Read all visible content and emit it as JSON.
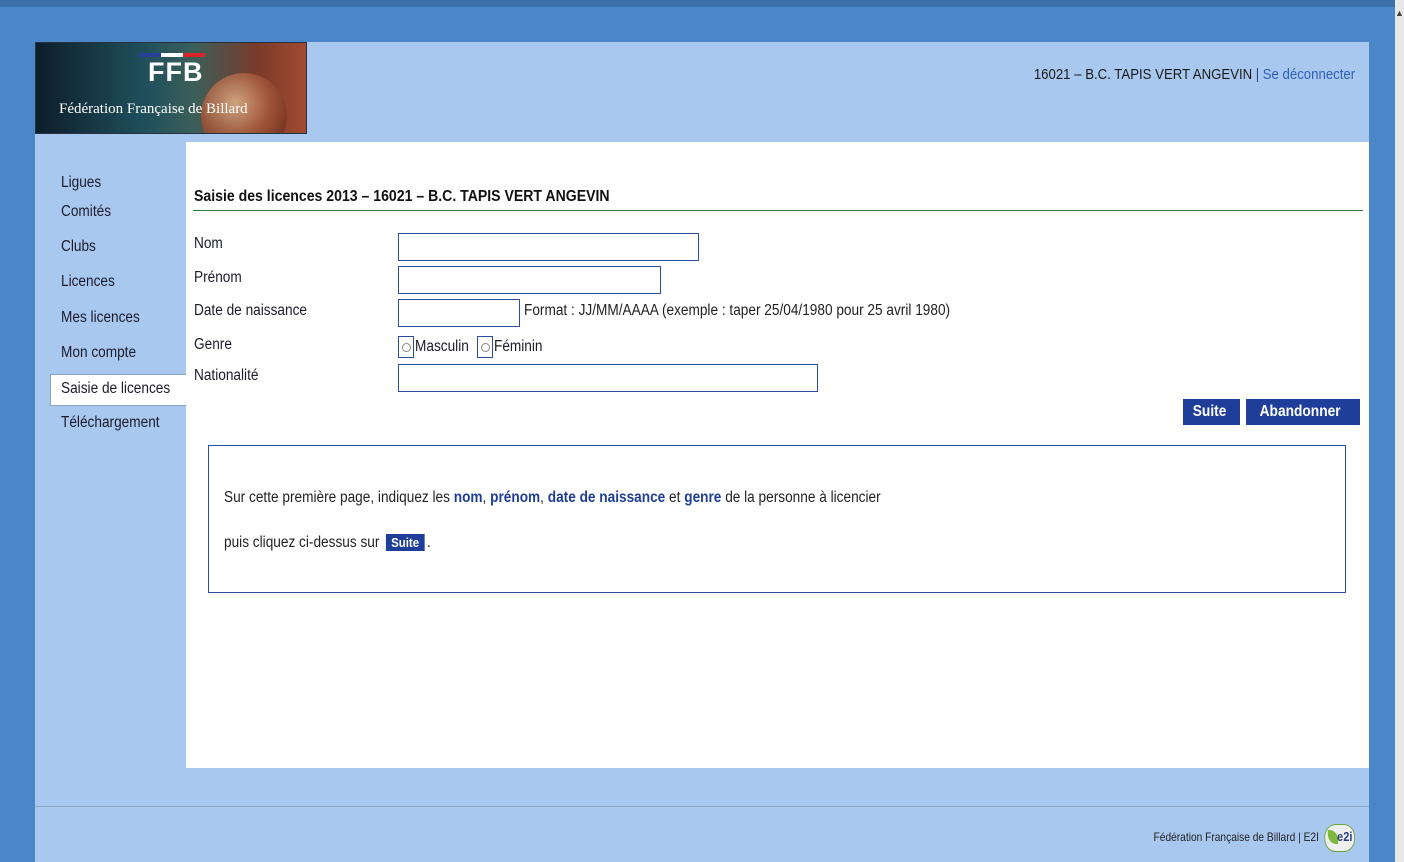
{
  "logo": {
    "brand": "FFB",
    "subtitle": "Fédération Française de Billard",
    "flag_colors": [
      "#2a3f9a",
      "#ffffff",
      "#d8232a"
    ]
  },
  "header": {
    "club": "16021 – B.C. TAPIS VERT ANGEVIN",
    "separator": "|",
    "logout": "Se déconnecter"
  },
  "sidebar": {
    "items": [
      {
        "label": "Ligues"
      },
      {
        "label": "Comités"
      },
      {
        "label": "Clubs"
      },
      {
        "label": "Licences"
      },
      {
        "label": "Mes licences"
      },
      {
        "label": "Mon compte"
      },
      {
        "label": "Saisie de licences",
        "active": true
      },
      {
        "label": "Téléchargement"
      }
    ]
  },
  "form": {
    "title": "Saisie des licences 2013 – 16021 – B.C. TAPIS VERT ANGEVIN",
    "nom_label": "Nom",
    "nom_value": "",
    "prenom_label": "Prénom",
    "prenom_value": "",
    "naissance_label": "Date de naissance",
    "naissance_value": "",
    "naissance_hint": "Format : JJ/MM/AAAA (exemple : taper 25/04/1980 pour 25 avril 1980)",
    "genre_label": "Genre",
    "genre_options": [
      "Masculin",
      "Féminin"
    ],
    "nationalite_label": "Nationalité",
    "nationalite_value": ""
  },
  "buttons": {
    "suite": "Suite",
    "abandonner": "Abandonner"
  },
  "info": {
    "line1_pre": "Sur cette première page, indiquez les",
    "nom": "nom",
    "comma1": ",",
    "prenom": "prénom",
    "comma2": ",",
    "date": "date de naissance",
    "et": "et",
    "genre": "genre",
    "line1_post": "de la personne à licencier",
    "line2_pre": "puis cliquez ci-dessus sur",
    "line2_btn": "Suite",
    "line2_post": "."
  },
  "footer": {
    "text": "Fédération Française de Billard | E2I",
    "badge": "e2i"
  },
  "colors": {
    "accent": "#1e3e99",
    "frame": "#a8c8f0",
    "background": "#4a86c8"
  }
}
